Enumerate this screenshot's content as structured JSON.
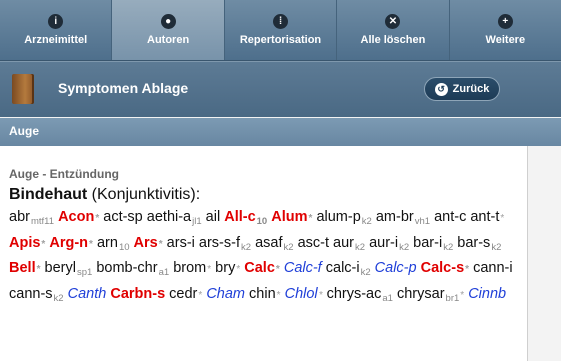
{
  "tabs": [
    {
      "name": "tab-arzneimittel",
      "label": "Arzneimittel",
      "icon": "info-icon",
      "glyph": "i",
      "active": false
    },
    {
      "name": "tab-autoren",
      "label": "Autoren",
      "icon": "person-icon",
      "glyph": "●",
      "active": true
    },
    {
      "name": "tab-repertorisation",
      "label": "Repertorisation",
      "icon": "grid-icon",
      "glyph": "⁞",
      "active": false
    },
    {
      "name": "tab-alle-loeschen",
      "label": "Alle löschen",
      "icon": "close-icon",
      "glyph": "✕",
      "active": false
    },
    {
      "name": "tab-weitere",
      "label": "Weitere",
      "icon": "plus-icon",
      "glyph": "+",
      "active": false
    }
  ],
  "header": {
    "title": "Symptomen Ablage",
    "icon": "book-icon",
    "back_label": "Zurück",
    "back_icon": "back-arrow-icon"
  },
  "section": {
    "title": "Auge"
  },
  "rubric": {
    "path": "Auge - Entzündung",
    "title_main": "Bindehaut",
    "title_sub": " (Konjunktivitis)",
    "title_suffix": ":"
  },
  "remedies": [
    {
      "abbr": "abr",
      "src": "mtf11",
      "grade": 1
    },
    {
      "abbr": "Acon",
      "dot": "*",
      "grade": 3
    },
    {
      "abbr": "act-sp",
      "grade": 1
    },
    {
      "abbr": "aethi-a",
      "src": "jl1",
      "grade": 1
    },
    {
      "abbr": "ail",
      "grade": 1
    },
    {
      "abbr": "All-c",
      "src": "10",
      "grade": 3
    },
    {
      "abbr": "Alum",
      "dot": "*",
      "grade": 3
    },
    {
      "abbr": "alum-p",
      "src": "k2",
      "grade": 1
    },
    {
      "abbr": "am-br",
      "src": "vh1",
      "grade": 1
    },
    {
      "abbr": "ant-c",
      "grade": 1
    },
    {
      "abbr": "ant-t",
      "dot": "*",
      "grade": 1
    },
    {
      "abbr": "Apis",
      "dot": "*",
      "grade": 3
    },
    {
      "abbr": "Arg-n",
      "dot": "*",
      "grade": 3
    },
    {
      "abbr": "arn",
      "src": "10",
      "grade": 1
    },
    {
      "abbr": "Ars",
      "dot": "*",
      "grade": 3
    },
    {
      "abbr": "ars-i",
      "grade": 1
    },
    {
      "abbr": "ars-s-f",
      "src": "k2",
      "grade": 1
    },
    {
      "abbr": "asaf",
      "src": "k2",
      "grade": 1
    },
    {
      "abbr": "asc-t",
      "grade": 1
    },
    {
      "abbr": "aur",
      "src": "k2",
      "grade": 1
    },
    {
      "abbr": "aur-i",
      "src": "k2",
      "grade": 1
    },
    {
      "abbr": "bar-i",
      "src": "k2",
      "grade": 1
    },
    {
      "abbr": "bar-s",
      "src": "k2",
      "grade": 1
    },
    {
      "abbr": "Bell",
      "dot": "*",
      "grade": 3
    },
    {
      "abbr": "beryl",
      "src": "sp1",
      "grade": 1
    },
    {
      "abbr": "bomb-chr",
      "src": "a1",
      "grade": 1
    },
    {
      "abbr": "brom",
      "dot": "*",
      "grade": 1
    },
    {
      "abbr": "bry",
      "dot": "*",
      "grade": 1
    },
    {
      "abbr": "Calc",
      "dot": "*",
      "grade": 3
    },
    {
      "abbr": "Calc-f",
      "grade": 2
    },
    {
      "abbr": "calc-i",
      "src": "k2",
      "grade": 1
    },
    {
      "abbr": "Calc-p",
      "grade": 2
    },
    {
      "abbr": "Calc-s",
      "dot": "*",
      "grade": 3
    },
    {
      "abbr": "cann-i",
      "grade": 1
    },
    {
      "abbr": "cann-s",
      "src": "k2",
      "grade": 1
    },
    {
      "abbr": "Canth",
      "grade": 2
    },
    {
      "abbr": "Carbn-s",
      "grade": 3
    },
    {
      "abbr": "cedr",
      "dot": "*",
      "grade": 1
    },
    {
      "abbr": "Cham",
      "grade": 2
    },
    {
      "abbr": "chin",
      "dot": "*",
      "grade": 1
    },
    {
      "abbr": "Chlol",
      "dot": "*",
      "grade": 2
    },
    {
      "abbr": "chrys-ac",
      "src": "a1",
      "grade": 1
    },
    {
      "abbr": "chrysar",
      "src": "br1",
      "dot": "*",
      "grade": 1
    },
    {
      "abbr": "Cinnb",
      "grade": 2
    }
  ],
  "colors": {
    "grade3": "#e00000",
    "grade2": "#1f3fd8",
    "grade1": "#111111",
    "tabbar": "#5e7d98"
  }
}
